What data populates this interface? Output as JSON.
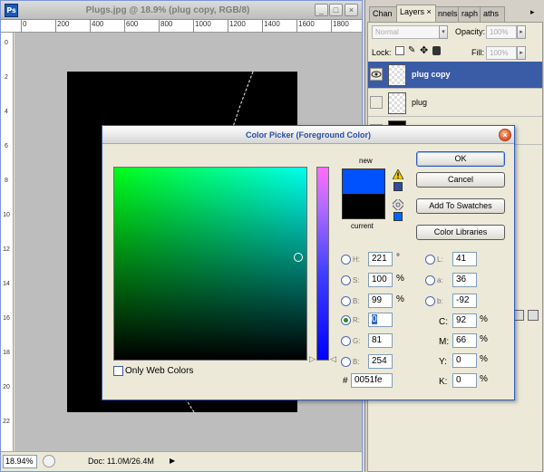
{
  "document": {
    "app_icon": "Ps",
    "title": "Plugs.jpg @ 18.9% (plug copy, RGB/8)",
    "title_buttons": [
      "_",
      "□",
      "×"
    ],
    "ruler_h_labels": [
      "0",
      "200",
      "400",
      "600",
      "800",
      "1000",
      "1200",
      "1400",
      "1600",
      "1800"
    ],
    "ruler_v_labels": [
      "0",
      "2",
      "4",
      "6",
      "8",
      "10",
      "12",
      "14",
      "16",
      "18",
      "20",
      "22"
    ],
    "status": {
      "zoom": "18.94%",
      "doc_info": "Doc: 11.0M/26.4M",
      "arrow": "▶"
    },
    "canvas_color": "#000000"
  },
  "panels": {
    "tabs": [
      "Chan",
      "Layers ×",
      "nnels",
      "raph",
      "aths"
    ],
    "blend_mode": "Normal",
    "opacity_label": "Opacity:",
    "opacity_value": "100%",
    "lock_label": "Lock:",
    "fill_label": "Fill:",
    "fill_value": "100%",
    "layers": [
      {
        "name": "plug copy",
        "selected": true,
        "visible": true
      },
      {
        "name": "plug",
        "selected": false,
        "visible": false
      },
      {
        "name": "",
        "selected": false,
        "visible": false
      }
    ]
  },
  "color_picker": {
    "title": "Color Picker (Foreground Color)",
    "close_glyph": "×",
    "new_label": "new",
    "current_label": "current",
    "new_color": "#0051fe",
    "current_color": "#000000",
    "buttons": {
      "ok": "OK",
      "cancel": "Cancel",
      "add_to_swatches": "Add To Swatches",
      "color_libraries": "Color Libraries"
    },
    "web_colors_label": "Only Web Colors",
    "hsb": [
      {
        "label": "H:",
        "value": "221",
        "unit": "°",
        "checked": false
      },
      {
        "label": "S:",
        "value": "100",
        "unit": "%",
        "checked": false
      },
      {
        "label": "B:",
        "value": "99",
        "unit": "%",
        "checked": false
      }
    ],
    "rgb": [
      {
        "label": "R:",
        "value": "0",
        "checked": true
      },
      {
        "label": "G:",
        "value": "81",
        "checked": false
      },
      {
        "label": "B:",
        "value": "254",
        "checked": false
      }
    ],
    "lab": [
      {
        "label": "L:",
        "value": "41"
      },
      {
        "label": "a:",
        "value": "36"
      },
      {
        "label": "b:",
        "value": "-92"
      }
    ],
    "cmyk": [
      {
        "label": "C:",
        "value": "92",
        "unit": "%"
      },
      {
        "label": "M:",
        "value": "66",
        "unit": "%"
      },
      {
        "label": "Y:",
        "value": "0",
        "unit": "%"
      },
      {
        "label": "K:",
        "value": "0",
        "unit": "%"
      }
    ],
    "hex_label": "#",
    "hex_value": "0051fe"
  }
}
